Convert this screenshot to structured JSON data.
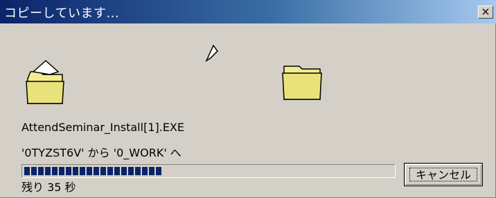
{
  "window": {
    "title": "コピーしています...",
    "close_label": "×"
  },
  "file": {
    "name": "AttendSeminar_Install[1].EXE"
  },
  "transfer": {
    "text": "'0TYZST6V' から '0_WORK' へ"
  },
  "progress": {
    "percent": 38
  },
  "status": {
    "remaining": "残り 35 秒"
  },
  "buttons": {
    "cancel": "キャンセル"
  }
}
